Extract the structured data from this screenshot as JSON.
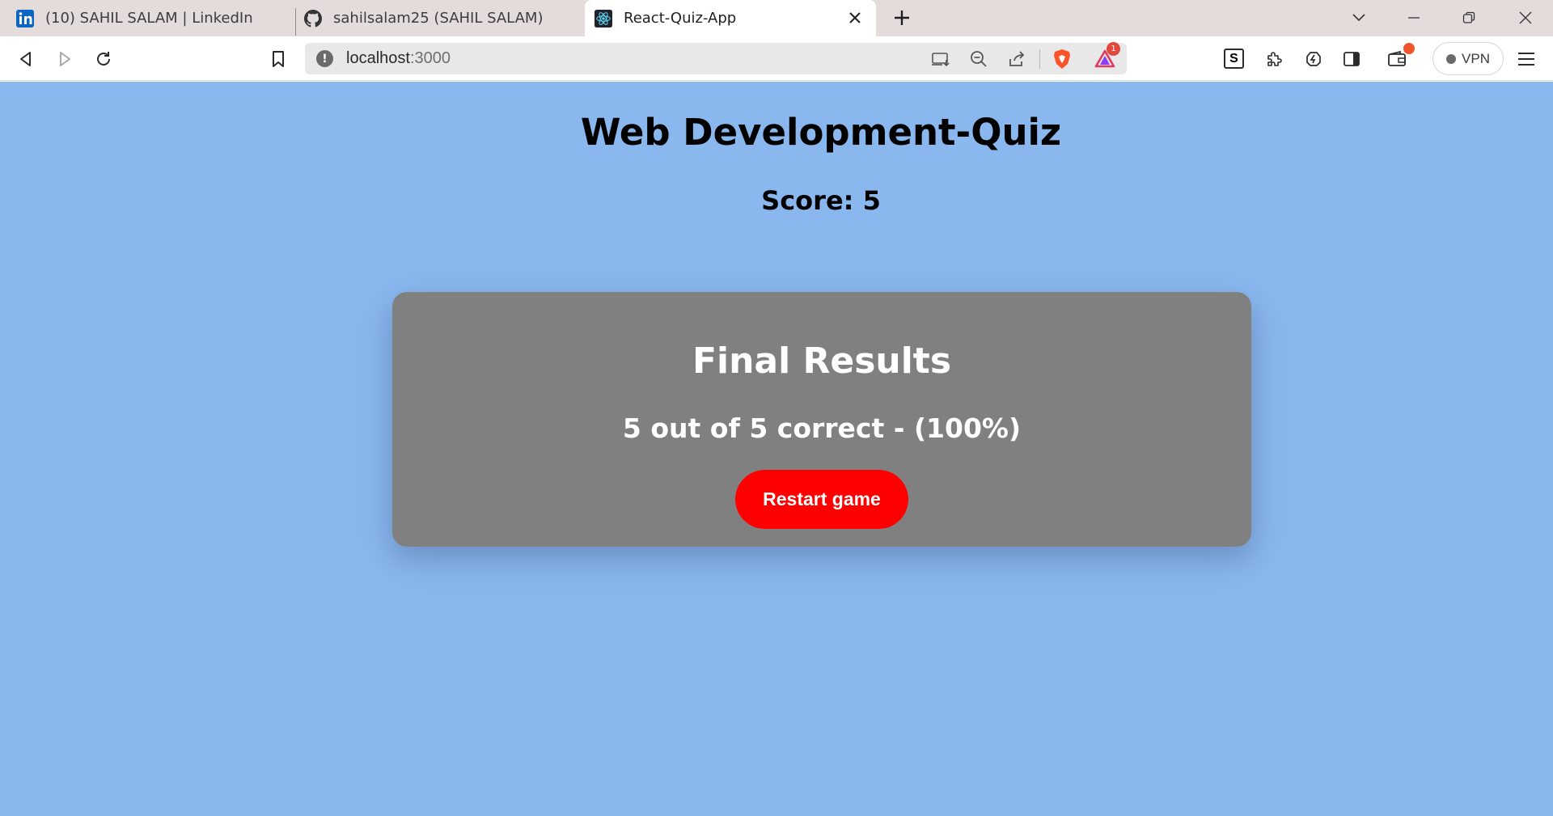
{
  "browser": {
    "tabs": [
      {
        "title": "(10) SAHIL SALAM | LinkedIn",
        "icon": "linkedin-icon"
      },
      {
        "title": "sahilsalam25 (SAHIL SALAM)",
        "icon": "github-icon"
      },
      {
        "title": "React-Quiz-App",
        "icon": "react-icon",
        "active": true
      }
    ],
    "url_host": "localhost",
    "url_port": ":3000",
    "shields_badge": "1",
    "extension_s": "S",
    "vpn_label": "VPN"
  },
  "quiz": {
    "title": "Web Development-Quiz",
    "score_text": "Score: 5"
  },
  "results": {
    "title": "Final Results",
    "summary": "5 out of 5 correct - (100%)",
    "restart_label": "Restart game"
  },
  "colors": {
    "page_background": "#8ab8ee",
    "card_background": "#808080",
    "restart_button": "#ff0000",
    "tabstrip": "#e3dcdb"
  }
}
